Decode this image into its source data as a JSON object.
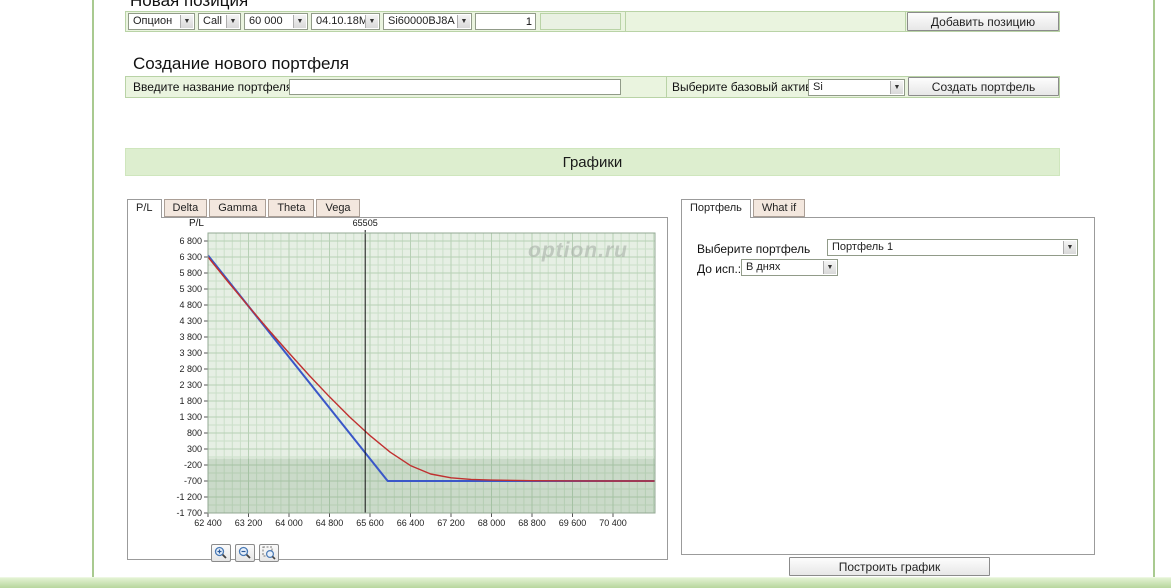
{
  "colors": {
    "accent_green_border": "#b9d3a6",
    "row_bg": "#eaf4df",
    "header_bar_bg": "#ddeecf",
    "tab_inactive_bg": "#f3e7de",
    "blue_line": "#3a57c8",
    "red_line": "#c03030"
  },
  "new_position": {
    "title": "Новая позиция",
    "type_value": "Опцион",
    "callput_value": "Call",
    "strike_value": "60 000",
    "date_value": "04.10.18М",
    "ticker_value": "Si60000BJ8A",
    "qty_value": "1",
    "price_value": "",
    "add_button": "Добавить позицию"
  },
  "portfolio_creation": {
    "title": "Создание нового портфеля",
    "name_label": "Введите название портфеля",
    "name_value": "",
    "asset_label": "Выберите базовый актив",
    "asset_value": "Si",
    "create_button": "Создать портфель"
  },
  "charts": {
    "title": "Графики",
    "left_tabs": [
      "P/L",
      "Delta",
      "Gamma",
      "Theta",
      "Vega"
    ],
    "right_tabs": [
      "Портфель",
      "What if"
    ],
    "watermark": "option.ru",
    "zoom_tools": [
      "zoom-in",
      "zoom-out",
      "zoom-selection"
    ],
    "portfolio_label": "Выберите портфель",
    "portfolio_value": "Портфель 1",
    "days_label": "До исп.:",
    "days_value": "В днях",
    "build_button": "Построить график"
  },
  "chart_data": {
    "type": "line",
    "title": "",
    "xlabel": "",
    "ylabel": "P/L",
    "legend": "none",
    "grid": true,
    "price_line": {
      "x": 65505,
      "label": "65505"
    },
    "xlim": [
      62400,
      71230
    ],
    "ylim": [
      -1700,
      7050
    ],
    "x_ticks": [
      62400,
      63200,
      64000,
      64800,
      65600,
      66400,
      67200,
      68000,
      68800,
      69600,
      70400
    ],
    "y_ticks": [
      6800,
      6300,
      5800,
      5300,
      4800,
      4300,
      3800,
      3300,
      2800,
      2300,
      1800,
      1300,
      800,
      300,
      -200,
      -700,
      -1200,
      -1700
    ],
    "x_minor_step": 160,
    "y_minor_step": 250,
    "shade_below": 0,
    "plot_bg": "#e6efe4",
    "grid_minor_color": "#cbdfc9",
    "grid_major_color": "#b7d0b5",
    "shade_color": "rgba(105,145,105,0.22)",
    "series": [
      {
        "name": "pl-at-expiration",
        "color": "#3a57c8",
        "width": 2,
        "points": [
          [
            62400,
            6350
          ],
          [
            65950,
            -700
          ],
          [
            71230,
            -700
          ]
        ]
      },
      {
        "name": "pl-current",
        "color": "#c03030",
        "width": 1.4,
        "points": [
          [
            62400,
            6300
          ],
          [
            62800,
            5520
          ],
          [
            63200,
            4760
          ],
          [
            63600,
            4020
          ],
          [
            64000,
            3300
          ],
          [
            64400,
            2600
          ],
          [
            64800,
            1930
          ],
          [
            65200,
            1300
          ],
          [
            65600,
            720
          ],
          [
            66000,
            200
          ],
          [
            66400,
            -220
          ],
          [
            66800,
            -480
          ],
          [
            67200,
            -600
          ],
          [
            67600,
            -650
          ],
          [
            68000,
            -672
          ],
          [
            68800,
            -690
          ],
          [
            69600,
            -696
          ],
          [
            70400,
            -699
          ],
          [
            71230,
            -700
          ]
        ]
      }
    ]
  }
}
